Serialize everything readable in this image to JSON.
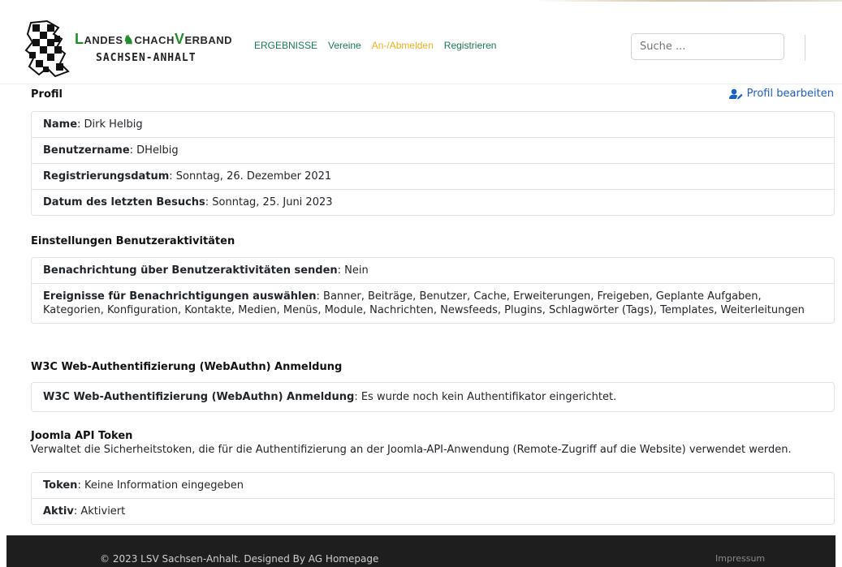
{
  "brand": {
    "line1_caps": [
      "L",
      "S",
      "V"
    ],
    "line1_parts": [
      "ANDES",
      "CHACH",
      "ERBAND"
    ],
    "line2": "SACHSEN-ANHALT"
  },
  "nav": {
    "items": [
      {
        "label": "ERGEBNISSE"
      },
      {
        "label": "Vereine"
      },
      {
        "label": "An-/Abmelden"
      },
      {
        "label": "Registrieren"
      }
    ],
    "active_index": 2
  },
  "search": {
    "placeholder": "Suche ..."
  },
  "profile": {
    "title": "Profil",
    "edit_label": "Profil bearbeiten",
    "fields": [
      {
        "label": "Name",
        "value": ": Dirk Helbig"
      },
      {
        "label": "Benutzername",
        "value": ": DHelbig"
      },
      {
        "label": "Registrierungsdatum",
        "value": ": Sonntag, 26. Dezember 2021"
      },
      {
        "label": "Datum des letzten Besuchs",
        "value": ": Sonntag, 25. Juni 2023"
      }
    ]
  },
  "activity": {
    "title": "Einstellungen Benutzeraktivitäten",
    "fields": [
      {
        "label": "Benachrichtung über Benutzeraktivitäten senden",
        "value": ": Nein"
      },
      {
        "label": "Ereignisse für Benachrichtigungen auswählen",
        "value": ": Banner, Beiträge, Benutzer, Cache, Erweiterungen, Freigeben, Geplante Aufgaben, Kategorien, Konfiguration, Kontakte, Medien, Menüs, Module, Nachrichten, Newsfeeds, Plugins, Schlagwörter (Tags), Templates, Weiterleitungen"
      }
    ]
  },
  "webauthn": {
    "title": "W3C Web-Authentifizierung (WebAuthn) Anmeldung",
    "fields": [
      {
        "label": "W3C Web-Authentifizierung (WebAuthn) Anmeldung",
        "value": ": Es wurde noch kein Authentifikator eingerichtet."
      }
    ]
  },
  "api": {
    "title": "Joomla API Token",
    "description": "Verwaltet die Sicherheitstoken, die für die Authentifizierung an der Joomla-API-Anwendung (Remote-Zugriff auf die Website) verwendet werden.",
    "fields": [
      {
        "label": "Token",
        "value": ": Keine Information eingegeben"
      },
      {
        "label": "Aktiv",
        "value": ": Aktiviert"
      }
    ]
  },
  "footer": {
    "copyright": "© 2023 LSV Sachsen-Anhalt. Designed By AG Homepage",
    "impressum": "Impressum"
  },
  "colors": {
    "nav_link": "#1c7a53",
    "nav_active": "#f0b020",
    "edit_link": "#1a5fc4",
    "footer_bg": "#1e1e1e"
  }
}
